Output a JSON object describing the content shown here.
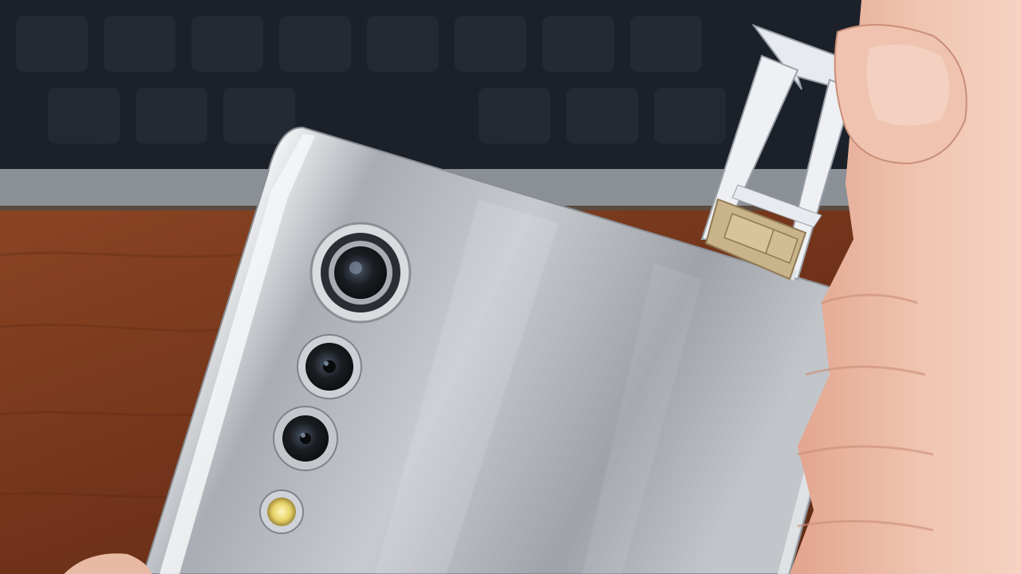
{
  "scene": {
    "subject": "smartphone-back-with-sim-tray",
    "palette": {
      "keyboard": "#1c2129",
      "desk_edge": "#8b9096",
      "wood": "#7a3a1f",
      "phone_body": "#b9bcc1",
      "phone_highlight": "#eef0f2",
      "lens_ring": "#d9dcdf",
      "lens_glass": "#1b1d22",
      "flash": "#f2e07a",
      "tray": "#e3e6ea",
      "sim_chip": "#c9b38a",
      "skin": "#e8b9a3",
      "skin_shadow": "#c98e78"
    },
    "camera_lens_count": 3,
    "has_flash": true
  }
}
